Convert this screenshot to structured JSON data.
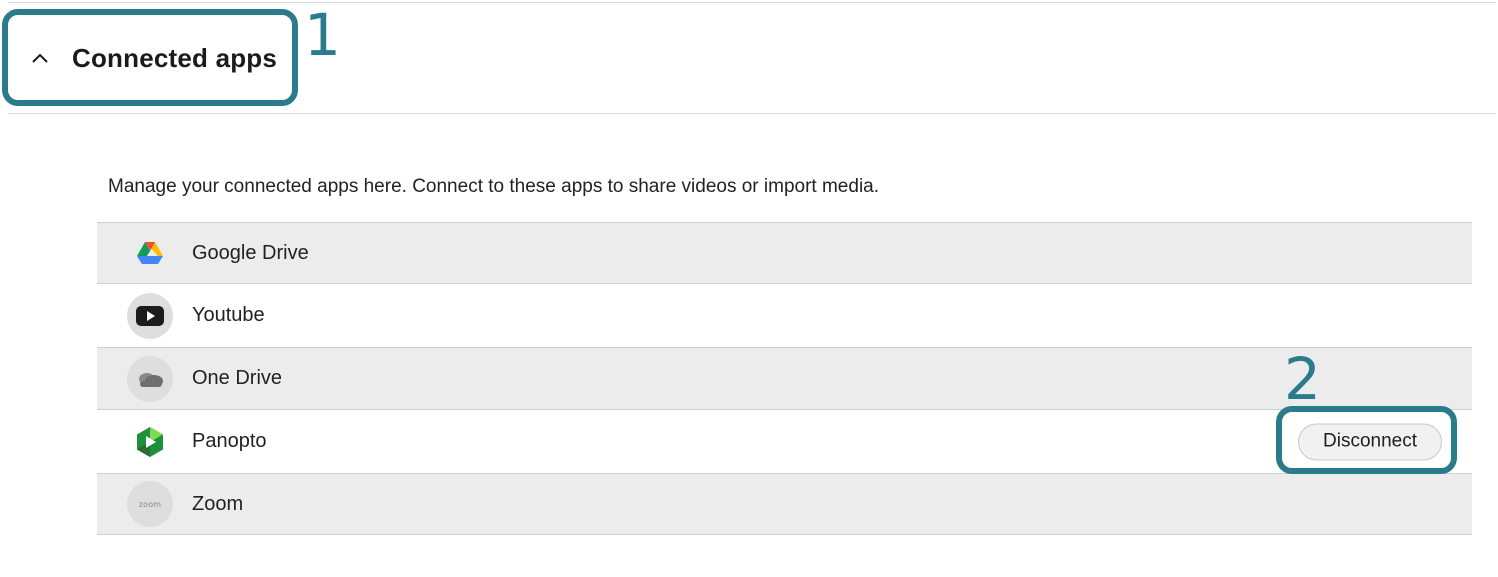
{
  "section": {
    "title": "Connected apps",
    "toggle_icon": "chevron-up-icon",
    "description": "Manage your connected apps here. Connect to these apps to share videos or import media."
  },
  "callouts": [
    "1",
    "2"
  ],
  "apps": [
    {
      "name": "Google Drive",
      "icon": "google-drive-icon",
      "shaded": true
    },
    {
      "name": "Youtube",
      "icon": "youtube-icon",
      "shaded": false
    },
    {
      "name": "One Drive",
      "icon": "onedrive-icon",
      "shaded": true
    },
    {
      "name": "Panopto",
      "icon": "panopto-icon",
      "shaded": false,
      "action": "Disconnect"
    },
    {
      "name": "Zoom",
      "icon": "zoom-icon",
      "icon_text": "zoom",
      "shaded": true
    }
  ],
  "colors": {
    "callout": "#2b7c8a",
    "row_shaded": "#ececec",
    "divider": "#cfcfcf"
  }
}
